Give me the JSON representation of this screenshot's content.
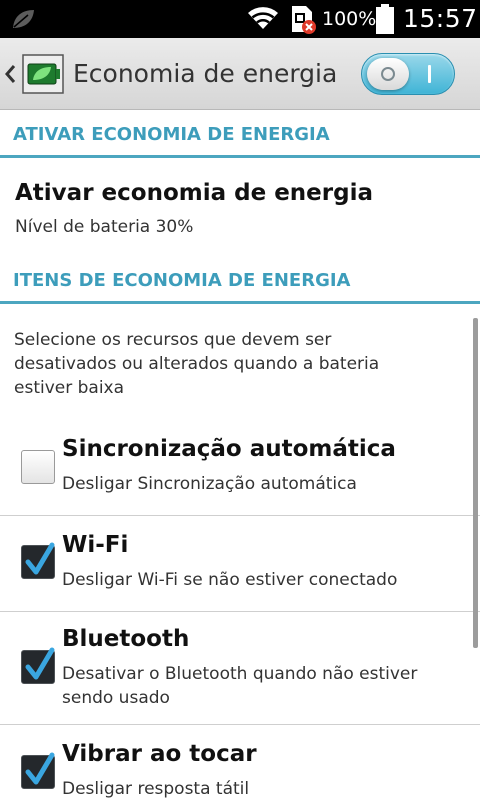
{
  "status_bar": {
    "battery_percent": "100%",
    "time": "15:57",
    "icons": [
      "leaf-icon",
      "wifi-icon",
      "sim-error-icon",
      "battery-icon"
    ]
  },
  "action_bar": {
    "title": "Economia de energia",
    "toggle_on": true,
    "accent_color": "#3fb4d6"
  },
  "sections": {
    "activate_header": "ATIVAR ECONOMIA DE ENERGIA",
    "activate_title": "Ativar economia de energia",
    "activate_summary": "Nível de bateria 30%",
    "items_header": "ITENS DE ECONOMIA DE ENERGIA",
    "items_description": "Selecione os recursos que devem ser desativados ou alterados quando a bateria estiver baixa"
  },
  "items": [
    {
      "title": "Sincronização automática",
      "summary": "Desligar Sincronização automática",
      "checked": false
    },
    {
      "title": "Wi-Fi",
      "summary": "Desligar Wi-Fi se não estiver conectado",
      "checked": true
    },
    {
      "title": "Bluetooth",
      "summary": "Desativar o Bluetooth quando não estiver sendo usado",
      "checked": true
    },
    {
      "title": "Vibrar ao tocar",
      "summary": "Desligar resposta tátil",
      "checked": true
    }
  ],
  "colors": {
    "section_header_text": "#3d9dbb",
    "section_divider": "#4ca6c0",
    "checkmark": "#3aa6e0"
  }
}
